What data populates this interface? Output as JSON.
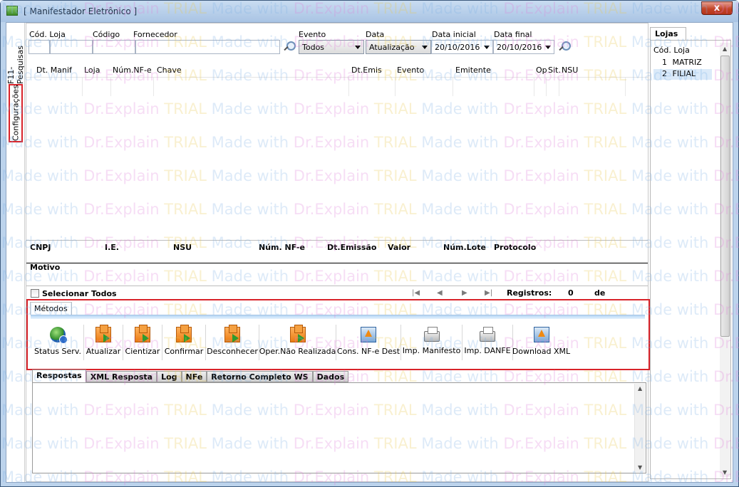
{
  "window": {
    "title": "[ Manifestador Eletrônico ]",
    "close_label": "x"
  },
  "side_tabs": [
    "F11-Pesquisas",
    "Configurações"
  ],
  "filters": {
    "cod_loja_label": "Cód. Loja",
    "codigo_label": "Código",
    "fornecedor_label": "Fornecedor",
    "evento_label": "Evento",
    "evento_value": "Todos",
    "data_label": "Data",
    "data_value": "Atualização",
    "data_inicial_label": "Data inicial",
    "data_inicial_value": "20/10/2016",
    "data_final_label": "Data final",
    "data_final_value": "20/10/2016"
  },
  "grid": {
    "columns": [
      "Dt. Manif",
      "Loja",
      "Núm.NF-e",
      "Chave",
      "Dt.Emis",
      "Evento",
      "Emitente",
      "Op",
      "Sit.",
      "NSU"
    ]
  },
  "detail": {
    "columns": [
      "CNPJ",
      "I.E.",
      "NSU",
      "Núm. NF-e",
      "Dt.Emissão",
      "Valor",
      "Núm.Lote",
      "Protocolo"
    ],
    "motivo_label": "Motivo"
  },
  "selection": {
    "select_all_label": "Selecionar Todos",
    "registros_label": "Registros:",
    "registros_value": "0",
    "de_label": "de"
  },
  "metodos": {
    "tab_label": "Métodos",
    "buttons": [
      "Status Serv.",
      "Atualizar",
      "Cientizar",
      "Confirmar",
      "Desconhecer",
      "Oper.Não Realizada",
      "Cons. NF-e Dest",
      "Imp. Manifesto",
      "Imp. DANFE",
      "Download XML"
    ]
  },
  "output_tabs": [
    "Respostas",
    "XML Resposta",
    "Log",
    "NFe",
    "Retorno Completo WS",
    "Dados"
  ],
  "lojas": {
    "tab_label": "Lojas",
    "header": "Cód. Loja",
    "rows": [
      {
        "code": "1",
        "name": "MATRIZ"
      },
      {
        "code": "2",
        "name": "FILIAL"
      }
    ]
  },
  "watermark": {
    "made": "Made with ",
    "dr": "Dr.Explain ",
    "trial": "TRIAL "
  },
  "colors": {
    "highlight_border": "#d9232a",
    "titlebar": "#b7cfea"
  }
}
